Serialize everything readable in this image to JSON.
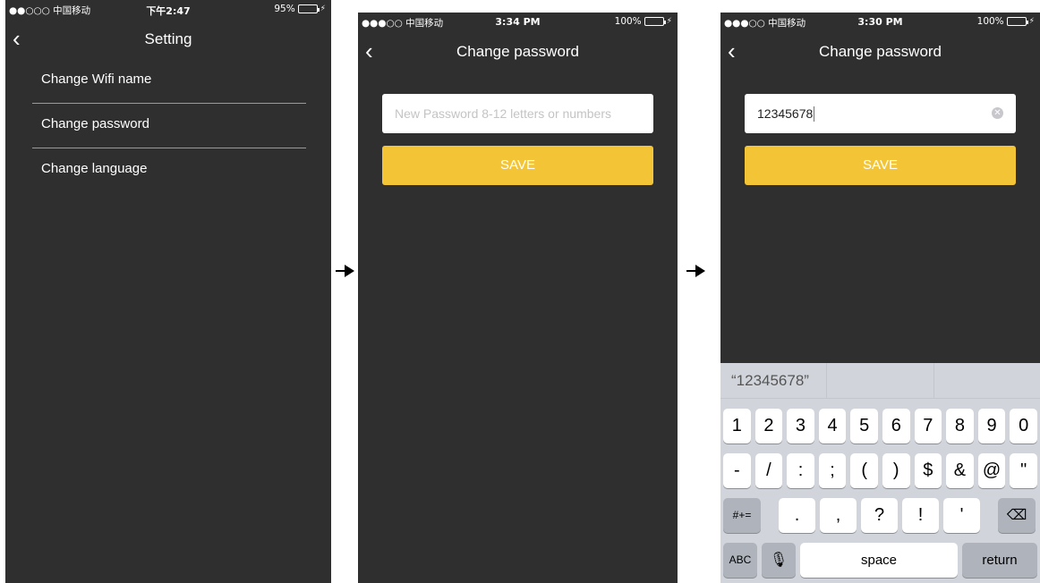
{
  "screens": [
    {
      "status": {
        "carrier": "●●○○○ 中国移动",
        "time": "下午2:47",
        "battery": "95%",
        "battery_level": 0.95
      },
      "nav": {
        "title": "Setting"
      },
      "menu": [
        {
          "label": "Change Wifi name"
        },
        {
          "label": "Change password"
        },
        {
          "label": "Change language"
        }
      ]
    },
    {
      "status": {
        "carrier": "●●●○○ 中国移动",
        "time": "3:34 PM",
        "battery": "100%",
        "battery_level": 1.0
      },
      "nav": {
        "title": "Change password"
      },
      "input": {
        "placeholder": "New Password 8-12 letters or numbers"
      },
      "save_label": "SAVE"
    },
    {
      "status": {
        "carrier": "●●●○○ 中国移动",
        "time": "3:30 PM",
        "battery": "100%",
        "battery_level": 1.0
      },
      "nav": {
        "title": "Change password"
      },
      "input": {
        "value": "12345678"
      },
      "save_label": "SAVE",
      "keyboard": {
        "suggestion": "“12345678”",
        "row1": [
          "1",
          "2",
          "3",
          "4",
          "5",
          "6",
          "7",
          "8",
          "9",
          "0"
        ],
        "row2": [
          "-",
          "/",
          ":",
          ";",
          "(",
          ")",
          "$",
          "&",
          "@",
          "\""
        ],
        "row3_left": "#+=",
        "row3": [
          ".",
          ",",
          "?",
          "!",
          "'"
        ],
        "abc": "ABC",
        "space": "space",
        "return": "return"
      }
    }
  ],
  "icons": {
    "back": "chevron-left-icon",
    "arrow": "arrow-right-icon",
    "clear": "clear-circle-icon",
    "mic": "microphone-icon",
    "delete": "backspace-icon"
  },
  "colors": {
    "background": "#2f2f2f",
    "accent": "#f3c536",
    "battery": "#4cd964"
  }
}
